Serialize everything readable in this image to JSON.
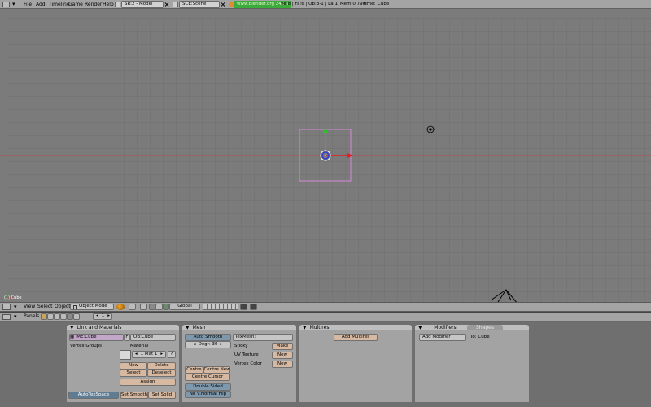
{
  "top_bar": {
    "menus": [
      "File",
      "Add",
      "Timeline",
      "Game",
      "Render",
      "Help"
    ],
    "screen_field": "SR:2 - Model",
    "scene_field": "SCE:Scene",
    "url_badge": "www.blender.org 242.6",
    "stats": "Ve:8 | Fa:6 | Ob:3-1 | La:1",
    "mem": "Mem:0.79M",
    "time": "Time:",
    "object_name": "Cube"
  },
  "viewport": {
    "object_label": "(1) Cube"
  },
  "view3d_header": {
    "menus": [
      "View",
      "Select",
      "Object"
    ],
    "mode": "Object Mode",
    "orientation": "Global"
  },
  "buttons_header": {
    "panels_label": "Panels",
    "frame_value": "1"
  },
  "panels": {
    "link_materials": {
      "title": "Link and Materials",
      "mesh_field": "ME:Cube",
      "f_label": "F",
      "ob_field": "OB:Cube",
      "vertex_groups": "Vertex Groups",
      "material": "Material",
      "mat_index": "1 Mat 1",
      "question": "?",
      "new": "New",
      "delete": "Delete",
      "select": "Select",
      "deselect": "Deselect",
      "assign": "Assign",
      "autotexspace": "AutoTexSpace",
      "set_smooth": "Set Smooth",
      "set_solid": "Set Solid"
    },
    "mesh": {
      "title": "Mesh",
      "auto_smooth": "Auto Smooth",
      "degr": "Degr: 30",
      "texmesh": "TexMesh:",
      "sticky": "Sticky",
      "make": "Make",
      "uv_texture": "UV Texture",
      "new1": "New",
      "vertex_color": "Vertex Color",
      "new2": "New",
      "centre": "Centre",
      "centre_new": "Centre New",
      "centre_cursor": "Centre Cursor",
      "double_sided": "Double Sided",
      "no_v_normal_flip": "No V.Normal Flip"
    },
    "multires": {
      "title": "Multires",
      "add_multires": "Add Multires"
    },
    "modifiers": {
      "tab1": "Modifiers",
      "tab2": "Shapes",
      "add_modifier": "Add Modifier",
      "to_label": "To: Cube"
    }
  },
  "colors": {
    "grid_bg": "#7b7b7b",
    "x_axis": "#b04a4a",
    "y_axis": "#3fa03f",
    "selection": "#d58ad6",
    "url_green": "#3cab3c"
  }
}
